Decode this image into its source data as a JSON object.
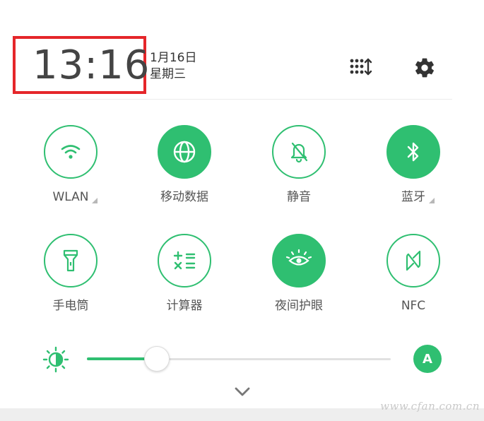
{
  "header": {
    "time": "13:16",
    "date": "1月16日",
    "weekday": "星期三",
    "edit_icon": "grid-reorder-icon",
    "settings_icon": "gear-icon"
  },
  "tiles": [
    {
      "label": "WLAN",
      "icon": "wifi-icon",
      "on": false,
      "expandable": true
    },
    {
      "label": "移动数据",
      "icon": "globe-icon",
      "on": true,
      "expandable": false
    },
    {
      "label": "静音",
      "icon": "bell-off-icon",
      "on": false,
      "expandable": false
    },
    {
      "label": "蓝牙",
      "icon": "bluetooth-icon",
      "on": true,
      "expandable": true
    },
    {
      "label": "手电筒",
      "icon": "flashlight-icon",
      "on": false,
      "expandable": false
    },
    {
      "label": "计算器",
      "icon": "calculator-icon",
      "on": false,
      "expandable": false
    },
    {
      "label": "夜间护眼",
      "icon": "eye-icon",
      "on": true,
      "expandable": false
    },
    {
      "label": "NFC",
      "icon": "nfc-icon",
      "on": false,
      "expandable": false
    }
  ],
  "brightness": {
    "level": 0.23,
    "auto_label": "A"
  },
  "watermark": "www.cfan.com.cn",
  "colors": {
    "accent": "#2fbf71",
    "highlight_box": "#e5262a"
  }
}
